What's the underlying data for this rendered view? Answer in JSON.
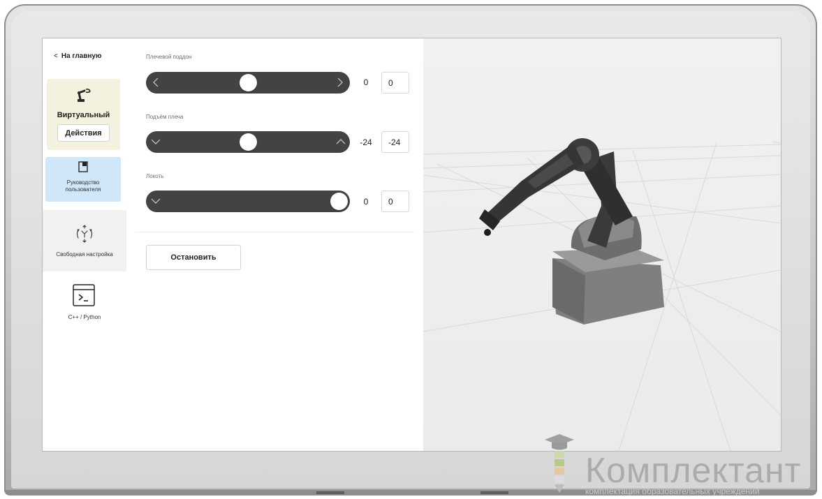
{
  "sidebar": {
    "back_label": "На главную",
    "virtual_card": {
      "title": "Виртуальный",
      "actions_label": "Действия",
      "icon": "robot-arm-icon"
    },
    "guide": {
      "line1": "Руководство",
      "line2": "пользователя",
      "icon": "book-icon"
    },
    "free_config": {
      "label": "Свободная настройка",
      "icon": "move-arrows-icon"
    },
    "code": {
      "label": "C++ / Python",
      "icon": "terminal-icon"
    }
  },
  "controls": {
    "sliders": [
      {
        "label": "Плечевой поддон",
        "value_display": "0",
        "input_value": "0",
        "left_icon": "chevron-left-icon",
        "right_icon": "chevron-right-icon",
        "position_fraction": 0.5
      },
      {
        "label": "Подъём плеча",
        "value_display": "-24",
        "input_value": "-24",
        "left_icon": "chevron-down-icon",
        "right_icon": "chevron-up-icon",
        "position_fraction": 0.5
      },
      {
        "label": "Локоть",
        "value_display": "0",
        "input_value": "0",
        "left_icon": "chevron-down-icon",
        "right_icon": "",
        "position_fraction": 1.0
      }
    ],
    "stop_label": "Остановить"
  },
  "watermark": {
    "brand": "Комплектант",
    "tagline": "комплектация образовательных учреждений"
  },
  "colors": {
    "slider_track": "#434343",
    "virtual_card_bg": "#f4f1de",
    "guide_card_bg": "#cfe7f8",
    "free_config_bg": "#f1f1f1",
    "viewport_bg": "#eeeeee"
  }
}
